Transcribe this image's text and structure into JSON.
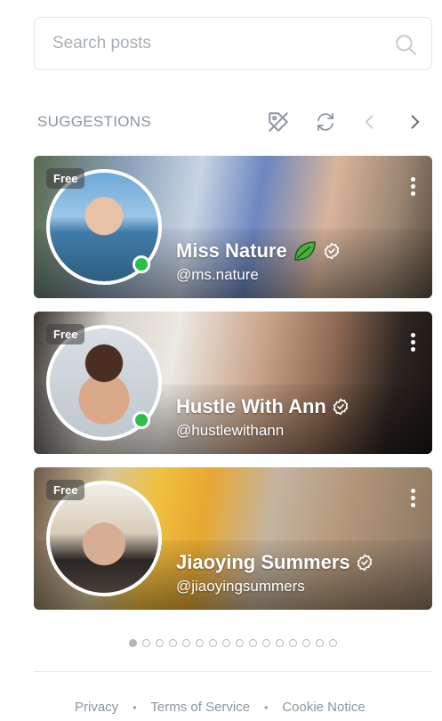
{
  "search": {
    "placeholder": "Search posts"
  },
  "suggestions": {
    "title": "SUGGESTIONS",
    "cards": [
      {
        "badge": "Free",
        "name": "Miss Nature",
        "handle": "@ms.nature",
        "online": true,
        "emoji": "leaf"
      },
      {
        "badge": "Free",
        "name": "Hustle With Ann",
        "handle": "@hustlewithann",
        "online": true
      },
      {
        "badge": "Free",
        "name": "Jiaoying Summers",
        "handle": "@jiaoyingsummers",
        "online": false
      }
    ],
    "pagination": {
      "total": 16,
      "active": 0
    }
  },
  "footer": {
    "links": [
      "Privacy",
      "Terms of Service",
      "Cookie Notice"
    ],
    "separator": "•"
  },
  "colors": {
    "accent": "#00aff0",
    "muted": "#8a96a3",
    "online": "#27c04a"
  }
}
